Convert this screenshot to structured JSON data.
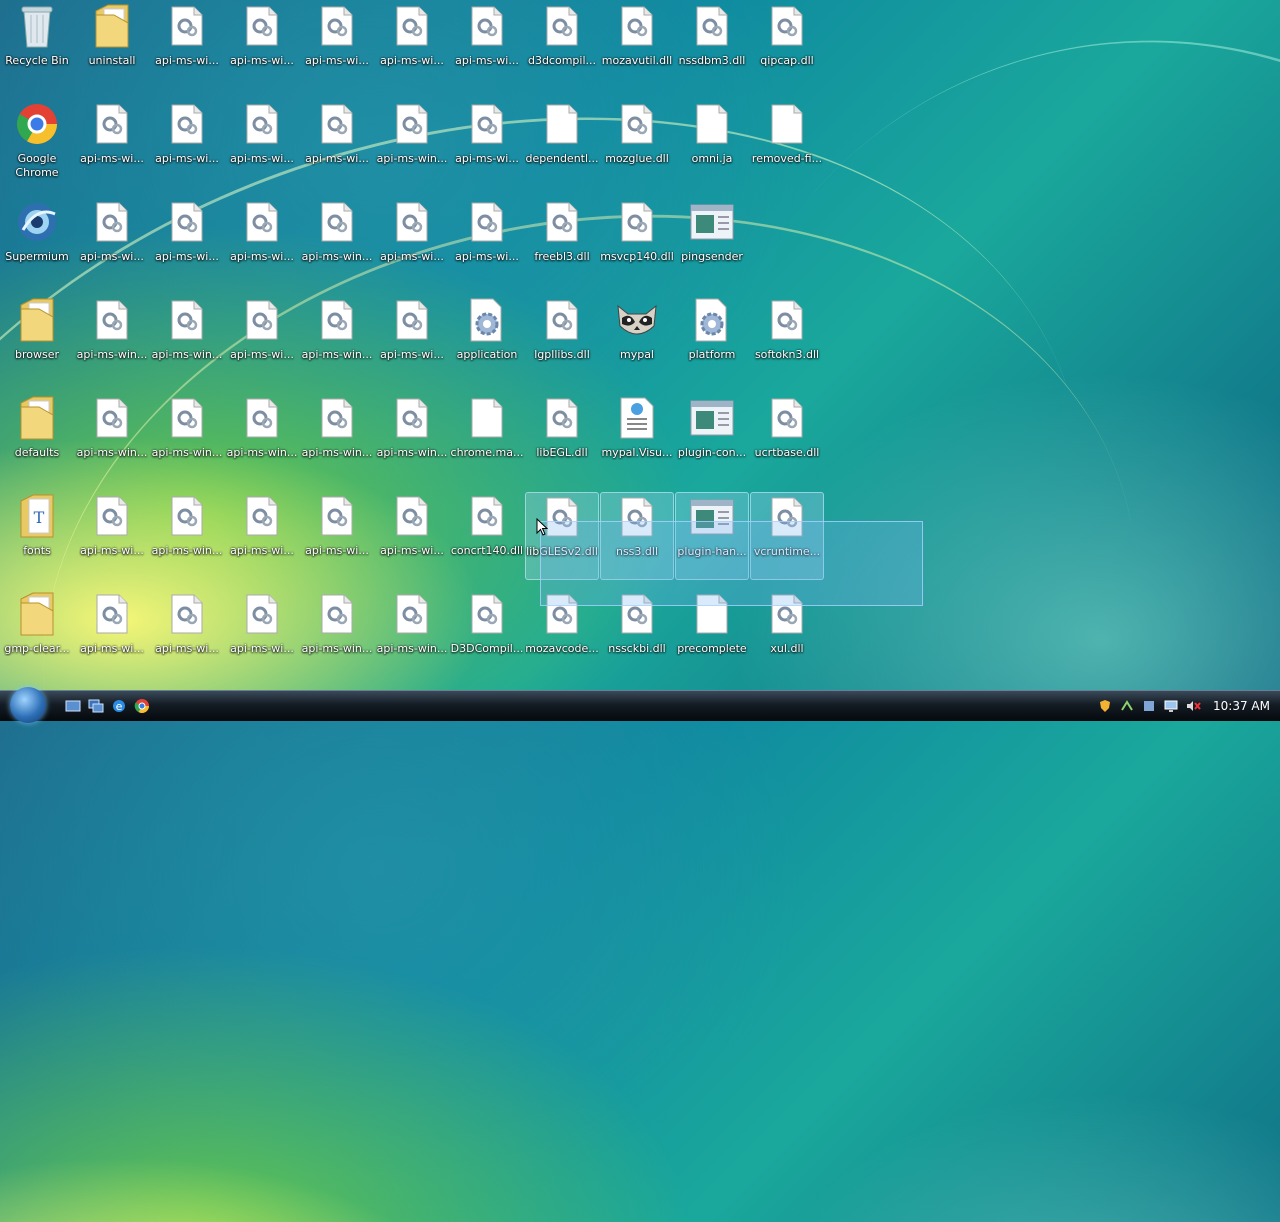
{
  "desktop": {
    "icons": [
      {
        "label": "Recycle Bin",
        "icon": "recycle-bin-icon"
      },
      {
        "label": "uninstall",
        "icon": "folder-icon"
      },
      {
        "label": "api-ms-wi...",
        "icon": "dll-file-icon"
      },
      {
        "label": "api-ms-wi...",
        "icon": "dll-file-icon"
      },
      {
        "label": "api-ms-wi...",
        "icon": "dll-file-icon"
      },
      {
        "label": "api-ms-wi...",
        "icon": "dll-file-icon"
      },
      {
        "label": "api-ms-wi...",
        "icon": "dll-file-icon"
      },
      {
        "label": "d3dcompil...",
        "icon": "dll-file-icon"
      },
      {
        "label": "mozavutil.dll",
        "icon": "dll-file-icon"
      },
      {
        "label": "nssdbm3.dll",
        "icon": "dll-file-icon"
      },
      {
        "label": "qipcap.dll",
        "icon": "dll-file-icon"
      },
      {
        "label": "Google Chrome",
        "icon": "chrome-icon"
      },
      {
        "label": "api-ms-wi...",
        "icon": "dll-file-icon"
      },
      {
        "label": "api-ms-wi...",
        "icon": "dll-file-icon"
      },
      {
        "label": "api-ms-wi...",
        "icon": "dll-file-icon"
      },
      {
        "label": "api-ms-wi...",
        "icon": "dll-file-icon"
      },
      {
        "label": "api-ms-win...",
        "icon": "dll-file-icon"
      },
      {
        "label": "api-ms-wi...",
        "icon": "dll-file-icon"
      },
      {
        "label": "dependentl...",
        "icon": "blank-file-icon"
      },
      {
        "label": "mozglue.dll",
        "icon": "dll-file-icon"
      },
      {
        "label": "omni.ja",
        "icon": "blank-file-icon"
      },
      {
        "label": "removed-fi...",
        "icon": "blank-file-icon"
      },
      {
        "label": "Supermium",
        "icon": "supermium-icon"
      },
      {
        "label": "api-ms-wi...",
        "icon": "dll-file-icon"
      },
      {
        "label": "api-ms-wi...",
        "icon": "dll-file-icon"
      },
      {
        "label": "api-ms-wi...",
        "icon": "dll-file-icon"
      },
      {
        "label": "api-ms-win...",
        "icon": "dll-file-icon"
      },
      {
        "label": "api-ms-wi...",
        "icon": "dll-file-icon"
      },
      {
        "label": "api-ms-wi...",
        "icon": "dll-file-icon"
      },
      {
        "label": "freebl3.dll",
        "icon": "dll-file-icon"
      },
      {
        "label": "msvcp140.dll",
        "icon": "dll-file-icon"
      },
      {
        "label": "pingsender",
        "icon": "exe-window-icon"
      },
      {
        "label": "browser",
        "icon": "folder-icon"
      },
      {
        "label": "api-ms-win...",
        "icon": "dll-file-icon"
      },
      {
        "label": "api-ms-win...",
        "icon": "dll-file-icon"
      },
      {
        "label": "api-ms-wi...",
        "icon": "dll-file-icon"
      },
      {
        "label": "api-ms-win...",
        "icon": "dll-file-icon"
      },
      {
        "label": "api-ms-wi...",
        "icon": "dll-file-icon"
      },
      {
        "label": "application",
        "icon": "settings-file-icon"
      },
      {
        "label": "lgpllibs.dll",
        "icon": "dll-file-icon"
      },
      {
        "label": "mypal",
        "icon": "raccoon-icon"
      },
      {
        "label": "platform",
        "icon": "settings-file-icon"
      },
      {
        "label": "softokn3.dll",
        "icon": "dll-file-icon"
      },
      {
        "label": "defaults",
        "icon": "folder-icon"
      },
      {
        "label": "api-ms-win...",
        "icon": "dll-file-icon"
      },
      {
        "label": "api-ms-win...",
        "icon": "dll-file-icon"
      },
      {
        "label": "api-ms-win...",
        "icon": "dll-file-icon"
      },
      {
        "label": "api-ms-win...",
        "icon": "dll-file-icon"
      },
      {
        "label": "api-ms-win...",
        "icon": "dll-file-icon"
      },
      {
        "label": "chrome.ma...",
        "icon": "blank-file-icon"
      },
      {
        "label": "libEGL.dll",
        "icon": "dll-file-icon"
      },
      {
        "label": "mypal.Visu...",
        "icon": "manifest-file-icon"
      },
      {
        "label": "plugin-con...",
        "icon": "exe-window-icon"
      },
      {
        "label": "ucrtbase.dll",
        "icon": "dll-file-icon"
      },
      {
        "label": "fonts",
        "icon": "fonts-folder-icon"
      },
      {
        "label": "api-ms-wi...",
        "icon": "dll-file-icon"
      },
      {
        "label": "api-ms-win...",
        "icon": "dll-file-icon"
      },
      {
        "label": "api-ms-wi...",
        "icon": "dll-file-icon"
      },
      {
        "label": "api-ms-wi...",
        "icon": "dll-file-icon"
      },
      {
        "label": "api-ms-wi...",
        "icon": "dll-file-icon"
      },
      {
        "label": "concrt140.dll",
        "icon": "dll-file-icon"
      },
      {
        "label": "libGLESv2.dll",
        "icon": "dll-file-icon",
        "selected": true
      },
      {
        "label": "nss3.dll",
        "icon": "dll-file-icon",
        "selected": true
      },
      {
        "label": "plugin-han...",
        "icon": "exe-window-icon",
        "selected": true
      },
      {
        "label": "vcruntime...",
        "icon": "dll-file-icon",
        "selected": true
      },
      {
        "label": "gmp-clear...",
        "icon": "folder-icon"
      },
      {
        "label": "api-ms-wi...",
        "icon": "dll-file-icon"
      },
      {
        "label": "api-ms-wi...",
        "icon": "dll-file-icon"
      },
      {
        "label": "api-ms-wi...",
        "icon": "dll-file-icon"
      },
      {
        "label": "api-ms-win...",
        "icon": "dll-file-icon"
      },
      {
        "label": "api-ms-win...",
        "icon": "dll-file-icon"
      },
      {
        "label": "D3DCompil...",
        "icon": "dll-file-icon"
      },
      {
        "label": "mozavcode...",
        "icon": "dll-file-icon"
      },
      {
        "label": "nssckbi.dll",
        "icon": "dll-file-icon"
      },
      {
        "label": "precomplete",
        "icon": "blank-file-icon"
      },
      {
        "label": "xul.dll",
        "icon": "dll-file-icon"
      }
    ]
  },
  "taskbar": {
    "start_icon": "windows-start-orb-icon",
    "quicklaunch": [
      "show-desktop-icon",
      "switch-windows-icon",
      "internet-explorer-icon",
      "chrome-icon"
    ],
    "tray": [
      "shield-icon",
      "network-icon",
      "update-icon",
      "monitor-icon",
      "volume-muted-icon"
    ],
    "clock": "10:37 AM"
  }
}
